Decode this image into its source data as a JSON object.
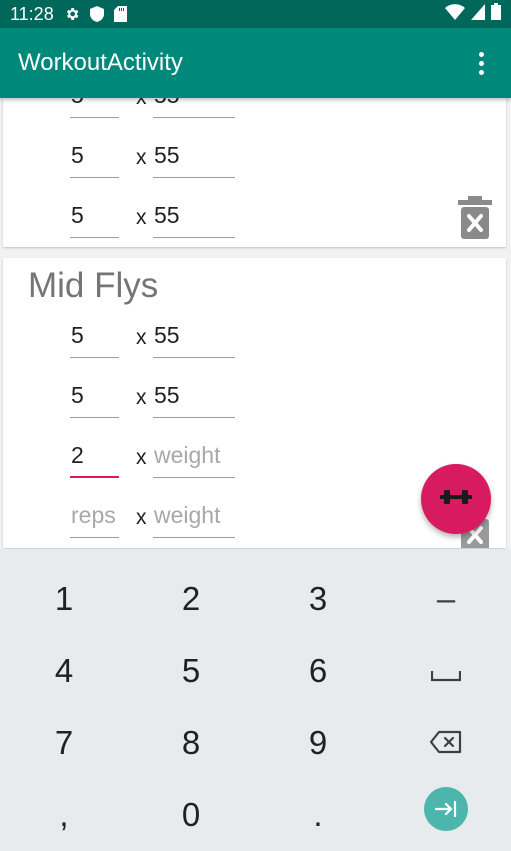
{
  "status_bar": {
    "time": "11:28",
    "icons": [
      "gear-icon",
      "shield-icon",
      "sd-card-icon",
      "wifi-icon",
      "signal-icon",
      "battery-icon"
    ]
  },
  "app_bar": {
    "title": "WorkoutActivity",
    "menu_icon": "more-vert-icon"
  },
  "exercises": [
    {
      "title": "",
      "sets": [
        {
          "reps": "5",
          "weight": "55"
        },
        {
          "reps": "5",
          "weight": "55"
        },
        {
          "reps": "5",
          "weight": "55"
        }
      ]
    },
    {
      "title": "Mid Flys",
      "sets": [
        {
          "reps": "5",
          "weight": "55"
        },
        {
          "reps": "5",
          "weight": "55"
        },
        {
          "reps": "2",
          "weight": ""
        }
      ],
      "new_set_placeholders": {
        "reps": "reps",
        "weight": "weight"
      }
    }
  ],
  "times_symbol": "x",
  "weight_placeholder": "weight",
  "fab_icon": "dumbbell-icon",
  "colors": {
    "status_bar": "#00675b",
    "app_bar": "#00897b",
    "accent": "#d81b60",
    "keyboard": "#e8ebee",
    "enter_key": "#4db6ac"
  },
  "keyboard": {
    "rows": [
      [
        "1",
        "2",
        "3",
        "–"
      ],
      [
        "4",
        "5",
        "6",
        "space"
      ],
      [
        "7",
        "8",
        "9",
        "backspace"
      ],
      [
        ",",
        "0",
        ".",
        "next"
      ]
    ]
  }
}
